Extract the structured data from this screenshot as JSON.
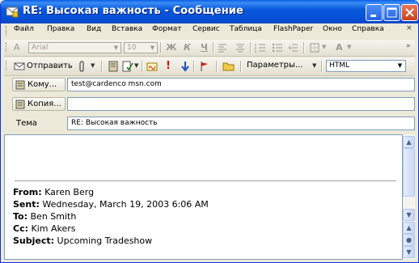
{
  "window": {
    "title": "RE: Высокая важность - Сообщение",
    "controls": [
      "minimize",
      "maximize",
      "close"
    ]
  },
  "menu": [
    "Файл",
    "Правка",
    "Вид",
    "Вставка",
    "Формат",
    "Сервис",
    "Таблица",
    "FlashPaper",
    "Окно",
    "Справка"
  ],
  "format_toolbar": {
    "font": "Arial",
    "size": "10",
    "bold": "Ж",
    "italic": "К",
    "underline": "Ч",
    "font_color_letter": "A"
  },
  "standard_toolbar": {
    "send_label": "Отправить",
    "options_label": "Параметры...",
    "format_select": "HTML"
  },
  "headers": {
    "to_label": "Кому...",
    "to_value": "test@cardenco msn.com",
    "cc_label": "Копия...",
    "cc_value": "",
    "subject_label": "Тема",
    "subject_value": "RE: Высокая важность"
  },
  "body": {
    "quoted": [
      {
        "label": "From:",
        "value": "Karen Berg"
      },
      {
        "label": "Sent:",
        "value": "Wednesday, March 19, 2003 6:06 AM"
      },
      {
        "label": "To:",
        "value": "Ben Smith"
      },
      {
        "label": "Cc:",
        "value": "Kim Akers"
      },
      {
        "label": "Subject:",
        "value": "Upcoming Tradeshow"
      }
    ]
  },
  "colors": {
    "titlebar": "#0a58dc",
    "window_bg": "#ece9d8",
    "field_border": "#7f9db9"
  }
}
